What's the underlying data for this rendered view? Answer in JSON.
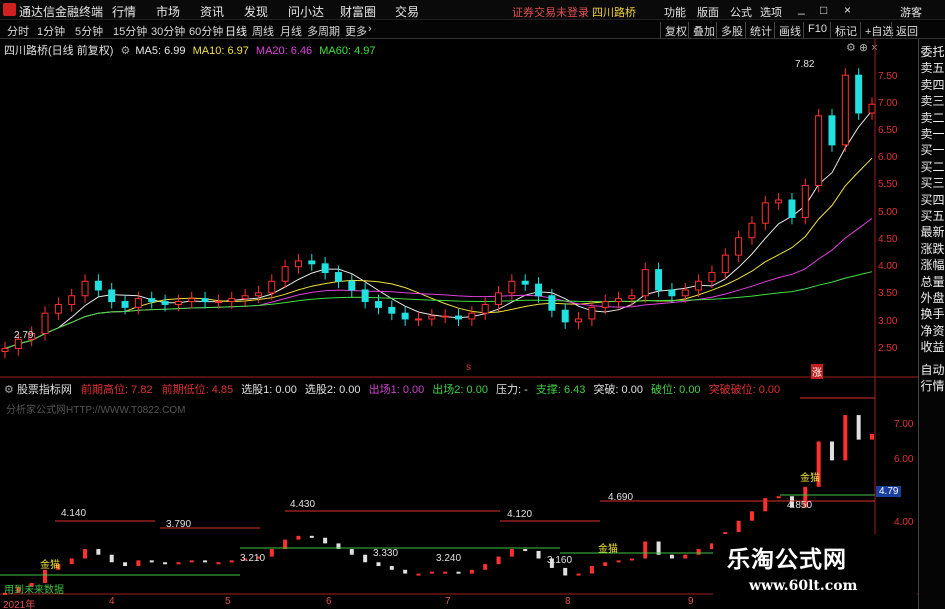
{
  "menu": {
    "app_title": "通达信金融终端",
    "items": [
      "行情",
      "市场",
      "资讯",
      "发现",
      "问小达",
      "财富圈",
      "交易"
    ],
    "notice": "证券交易未登录",
    "stock": "四川路桥",
    "right_items": [
      "功能",
      "版面",
      "公式",
      "选项"
    ],
    "right_extra": "游客",
    "window_controls": [
      "_",
      "□",
      "×"
    ]
  },
  "toolbar": {
    "periods": [
      "分时",
      "1分钟",
      "5分钟",
      "15分钟",
      "30分钟",
      "60分钟",
      "日线",
      "周线",
      "月线",
      "多周期",
      "更多"
    ],
    "right": [
      "复权",
      "叠加",
      "多股",
      "统计",
      "画线",
      "F10",
      "标记",
      "+自选",
      "返回"
    ]
  },
  "main": {
    "title": "四川路桥(日线 前复权)",
    "ma": [
      {
        "label": "MA5: 6.99",
        "color": "#e8e8e8"
      },
      {
        "label": "MA10: 6.97",
        "color": "#f0e040"
      },
      {
        "label": "MA20: 6.46",
        "color": "#e040e0"
      },
      {
        "label": "MA60: 4.97",
        "color": "#40e040"
      }
    ],
    "y_ticks": [
      "7.50",
      "7.00",
      "6.50",
      "6.00",
      "5.50",
      "5.00",
      "4.50",
      "4.00",
      "3.50",
      "3.00",
      "2.50"
    ],
    "high_label": "7.82",
    "low_label": "2.79",
    "marker_s": "s",
    "marker_b": "涨"
  },
  "indicator": {
    "title": "股票指标网",
    "items": [
      {
        "label": "前期高位: 7.82",
        "color": "#e03030"
      },
      {
        "label": "前期低位: 4.85",
        "color": "#e03030"
      },
      {
        "label": "选股1: 0.00",
        "color": "#e0e0e0"
      },
      {
        "label": "选股2: 0.00",
        "color": "#e0e0e0"
      },
      {
        "label": "出场1: 0.00",
        "color": "#d040d0"
      },
      {
        "label": "出场2: 0.00",
        "color": "#40d040"
      },
      {
        "label": "压力: -",
        "color": "#e0e0e0"
      },
      {
        "label": "支撑: 6.43",
        "color": "#40d040"
      },
      {
        "label": "突破: 0.00",
        "color": "#e0e0e0"
      },
      {
        "label": "破位: 0.00",
        "color": "#40d040"
      },
      {
        "label": "突破破位: 0.00",
        "color": "#e03030"
      }
    ],
    "source_note": "分析家公式网HTTP://WWW.T0822.COM",
    "bottom_note": "用到未来数据",
    "y_ticks": [
      "7.00",
      "6.00",
      "4.79",
      "4.00"
    ],
    "price_labels": [
      "4.140",
      "3.790",
      "4.430",
      "4.120",
      "4.690",
      "4.850",
      "3.210",
      "3.330",
      "3.240",
      "3.160"
    ],
    "signal": "金猫"
  },
  "x_axis": [
    "2021年",
    "4",
    "5",
    "6",
    "7",
    "8",
    "9"
  ],
  "right_panel": [
    "委托",
    "卖五",
    "卖四",
    "卖三",
    "卖二",
    "卖一",
    "买一",
    "买二",
    "买三",
    "买四",
    "买五",
    "最新",
    "涨跌",
    "涨幅",
    "总量",
    "外盘",
    "换手",
    "净资",
    "收益",
    "自动",
    "行情"
  ],
  "watermark": {
    "name": "乐淘公式网",
    "url": "www.60lt.com"
  },
  "chart_data": {
    "type": "candlestick",
    "title": "四川路桥(日线 前复权)",
    "xlabel": "",
    "ylabel": "",
    "ylim": [
      2.3,
      7.9
    ],
    "x_ticks": [
      "2021年",
      "4",
      "5",
      "6",
      "7",
      "8",
      "9"
    ],
    "annotations": {
      "high": 7.82,
      "low": 2.79
    },
    "moving_averages": {
      "MA5": 6.99,
      "MA10": 6.97,
      "MA20": 6.46,
      "MA60": 4.97
    },
    "close_series": [
      2.79,
      2.95,
      3.05,
      3.4,
      3.55,
      3.7,
      3.95,
      3.8,
      3.6,
      3.5,
      3.65,
      3.6,
      3.55,
      3.6,
      3.65,
      3.6,
      3.6,
      3.65,
      3.7,
      3.75,
      3.95,
      4.2,
      4.3,
      4.25,
      4.1,
      3.95,
      3.8,
      3.6,
      3.5,
      3.4,
      3.3,
      3.3,
      3.35,
      3.35,
      3.3,
      3.4,
      3.55,
      3.75,
      3.95,
      3.9,
      3.7,
      3.45,
      3.25,
      3.3,
      3.5,
      3.6,
      3.65,
      3.7,
      4.15,
      3.8,
      3.7,
      3.8,
      3.95,
      4.1,
      4.4,
      4.7,
      4.95,
      5.3,
      5.35,
      5.05,
      5.6,
      6.8,
      6.3,
      7.5,
      6.85,
      7.0
    ]
  }
}
